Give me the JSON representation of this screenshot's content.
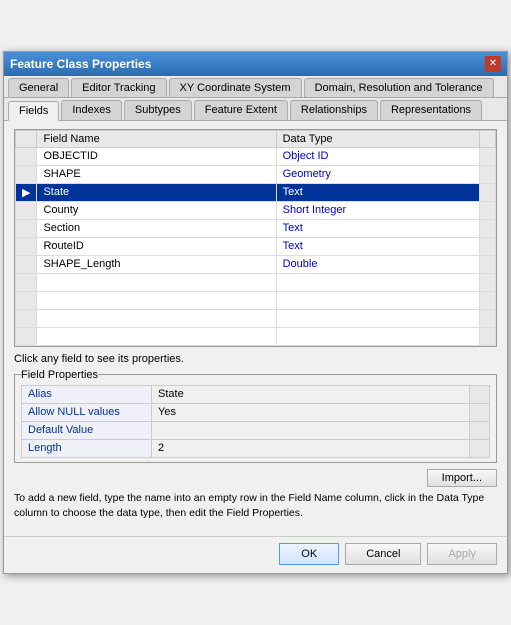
{
  "window": {
    "title": "Feature Class Properties"
  },
  "tabs_row1": {
    "items": [
      {
        "label": "General",
        "active": false
      },
      {
        "label": "Editor Tracking",
        "active": false
      },
      {
        "label": "XY Coordinate System",
        "active": false
      },
      {
        "label": "Domain, Resolution and Tolerance",
        "active": false
      }
    ]
  },
  "tabs_row2": {
    "items": [
      {
        "label": "Fields",
        "active": true
      },
      {
        "label": "Indexes",
        "active": false
      },
      {
        "label": "Subtypes",
        "active": false
      },
      {
        "label": "Feature Extent",
        "active": false
      },
      {
        "label": "Relationships",
        "active": false
      },
      {
        "label": "Representations",
        "active": false
      }
    ]
  },
  "field_table": {
    "columns": [
      "Field Name",
      "Data Type"
    ],
    "rows": [
      {
        "indicator": "",
        "name": "OBJECTID",
        "type": "Object ID",
        "selected": false
      },
      {
        "indicator": "",
        "name": "SHAPE",
        "type": "Geometry",
        "selected": false
      },
      {
        "indicator": "▶",
        "name": "State",
        "type": "Text",
        "selected": true
      },
      {
        "indicator": "",
        "name": "County",
        "type": "Short Integer",
        "selected": false
      },
      {
        "indicator": "",
        "name": "Section",
        "type": "Text",
        "selected": false
      },
      {
        "indicator": "",
        "name": "RouteID",
        "type": "Text",
        "selected": false
      },
      {
        "indicator": "",
        "name": "SHAPE_Length",
        "type": "Double",
        "selected": false
      },
      {
        "indicator": "",
        "name": "",
        "type": "",
        "selected": false
      },
      {
        "indicator": "",
        "name": "",
        "type": "",
        "selected": false
      },
      {
        "indicator": "",
        "name": "",
        "type": "",
        "selected": false
      },
      {
        "indicator": "",
        "name": "",
        "type": "",
        "selected": false
      }
    ]
  },
  "hint": "Click any field to see its properties.",
  "properties_group": {
    "legend": "Field Properties",
    "rows": [
      {
        "label": "Alias",
        "value": "State",
        "has_extra": true
      },
      {
        "label": "Allow NULL values",
        "value": "Yes",
        "has_extra": true
      },
      {
        "label": "Default Value",
        "value": "",
        "has_extra": true
      },
      {
        "label": "Length",
        "value": "2",
        "has_extra": true
      }
    ]
  },
  "import_btn": "Import...",
  "bottom_text": "To add a new field, type the name into an empty row in the Field Name column, click in the Data Type column to choose the data type, then edit the Field Properties.",
  "buttons": {
    "ok": "OK",
    "cancel": "Cancel",
    "apply": "Apply"
  }
}
